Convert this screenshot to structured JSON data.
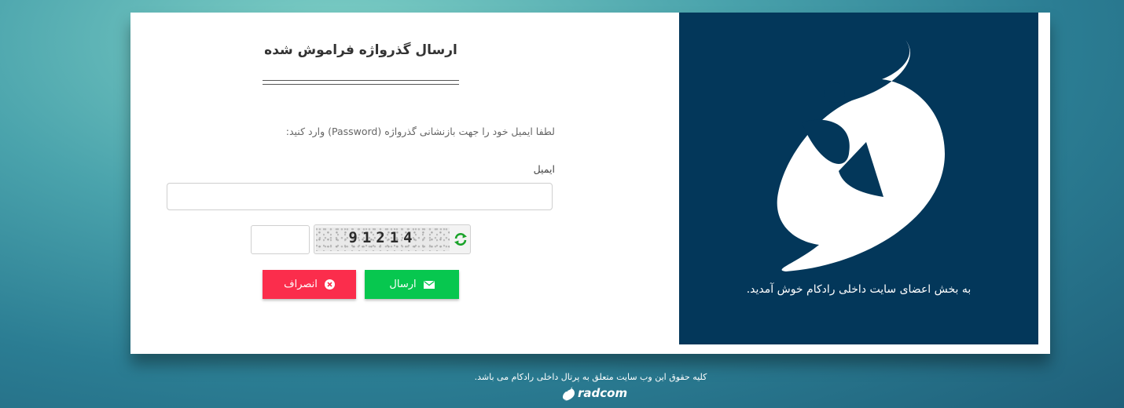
{
  "form": {
    "title": "ارسال گذرواژه فراموش شده",
    "instruction": "لطفا ایمیل خود را جهت بازنشانی گذرواژه (Password) وارد کنید:",
    "email_label": "ایمیل",
    "email_value": "",
    "captcha_input_value": "",
    "captcha_text": "91214",
    "send_label": "ارسال",
    "cancel_label": "انصراف"
  },
  "brand": {
    "welcome": "به بخش اعضای سایت داخلی رادکام خوش آمدید."
  },
  "footer": {
    "copyright": "کلیه حقوق این وب سایت متعلق به پرتال داخلی رادکام می باشد.",
    "logo_text": "radcom"
  },
  "colors": {
    "brand_panel": "#03375a",
    "send_button": "#07c74f",
    "cancel_button": "#fb2d4c"
  },
  "icons": {
    "send": "envelope-icon",
    "cancel": "close-circle-icon",
    "captcha_refresh": "refresh-icon"
  }
}
